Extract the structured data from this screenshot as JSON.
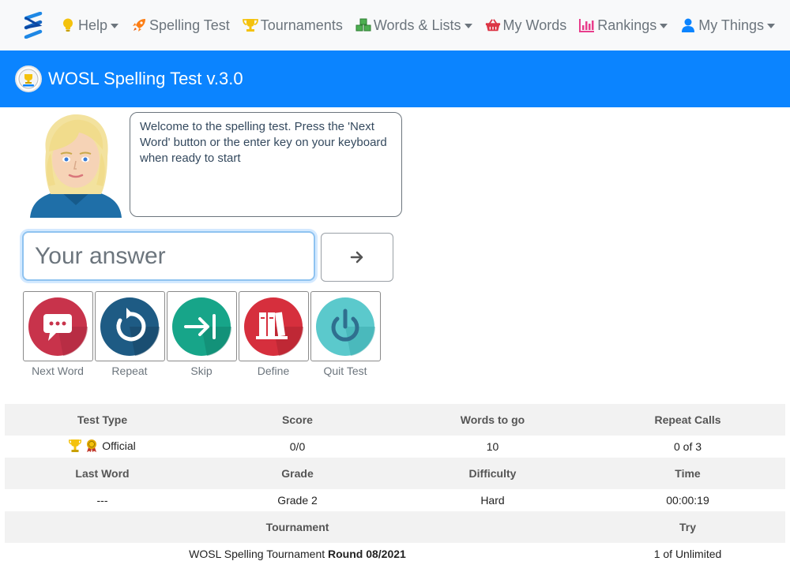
{
  "nav": {
    "items": [
      {
        "label": "Help",
        "icon": "lightbulb-icon",
        "dropdown": true,
        "color": "#f4c20d"
      },
      {
        "label": "Spelling Test",
        "icon": "rocket-icon",
        "dropdown": false,
        "color": "#fd7e14"
      },
      {
        "label": "Tournaments",
        "icon": "trophy-icon",
        "dropdown": false,
        "color": "#f4c20d"
      },
      {
        "label": "Words & Lists",
        "icon": "cubes-icon",
        "dropdown": true,
        "color": "#4caf50"
      },
      {
        "label": "My Words",
        "icon": "basket-icon",
        "dropdown": false,
        "color": "#dc3545"
      },
      {
        "label": "Rankings",
        "icon": "bar-chart-icon",
        "dropdown": true,
        "color": "#e83e8c"
      },
      {
        "label": "My Things",
        "icon": "user-icon",
        "dropdown": true,
        "color": "#0b84ff"
      }
    ]
  },
  "header": {
    "title": "WOSL Spelling Test v.3.0",
    "bg": "#0b84ff"
  },
  "speech": {
    "text": "Welcome to the spelling test. Press the 'Next Word' button or the enter key on your keyboard when ready to start"
  },
  "answer": {
    "placeholder": "Your answer",
    "value": ""
  },
  "actions": [
    {
      "label": "Next Word",
      "color": "#c8334b"
    },
    {
      "label": "Repeat",
      "color": "#1e5b84"
    },
    {
      "label": "Skip",
      "color": "#17a589"
    },
    {
      "label": "Define",
      "color": "#d62f3d"
    },
    {
      "label": "Quit Test",
      "color": "#5bc9cc"
    }
  ],
  "stats": {
    "row1_headers": [
      "Test Type",
      "Score",
      "Words to go",
      "Repeat Calls"
    ],
    "test_type": "Official",
    "score": "0/0",
    "words_to_go": "10",
    "repeat_calls": "0 of 3",
    "row2_headers": [
      "Last Word",
      "Grade",
      "Difficulty",
      "Time"
    ],
    "last_word": "---",
    "grade": "Grade 2",
    "difficulty": "Hard",
    "time": "00:00:19",
    "row3_headers": [
      "Tournament",
      "Try"
    ],
    "tournament_name": "WOSL Spelling Tournament",
    "tournament_round": "Round 08/2021",
    "try": "1 of Unlimited"
  }
}
